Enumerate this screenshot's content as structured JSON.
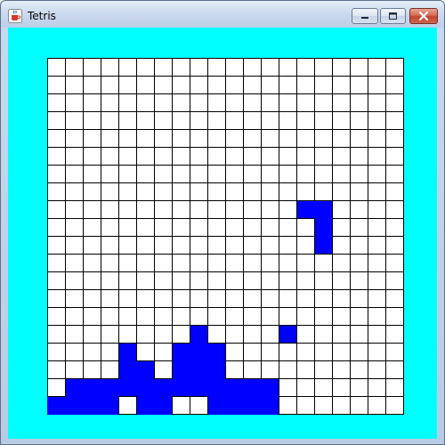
{
  "window": {
    "title": "Tetris",
    "app_icon": "java-cup-icon",
    "buttons": {
      "minimize": "minimize-icon",
      "maximize": "maximize-icon",
      "close": "close-icon"
    }
  },
  "colors": {
    "background": "#00ffff",
    "block": "#0000ff",
    "empty_cell": "#ffffff",
    "grid_line": "#000000"
  },
  "board": {
    "columns": 20,
    "rows": 20,
    "falling_piece": [
      [
        8,
        14
      ],
      [
        8,
        15
      ],
      [
        9,
        15
      ],
      [
        10,
        15
      ]
    ],
    "locked_cells": [
      [
        15,
        8
      ],
      [
        15,
        13
      ],
      [
        16,
        4
      ],
      [
        16,
        7
      ],
      [
        16,
        8
      ],
      [
        16,
        9
      ],
      [
        17,
        4
      ],
      [
        17,
        5
      ],
      [
        17,
        7
      ],
      [
        17,
        8
      ],
      [
        17,
        9
      ],
      [
        18,
        1
      ],
      [
        18,
        2
      ],
      [
        18,
        3
      ],
      [
        18,
        4
      ],
      [
        18,
        5
      ],
      [
        18,
        6
      ],
      [
        18,
        7
      ],
      [
        18,
        8
      ],
      [
        18,
        9
      ],
      [
        18,
        10
      ],
      [
        18,
        11
      ],
      [
        18,
        12
      ],
      [
        19,
        0
      ],
      [
        19,
        1
      ],
      [
        19,
        2
      ],
      [
        19,
        3
      ],
      [
        19,
        5
      ],
      [
        19,
        6
      ],
      [
        19,
        9
      ],
      [
        19,
        10
      ],
      [
        19,
        11
      ],
      [
        19,
        12
      ]
    ]
  }
}
